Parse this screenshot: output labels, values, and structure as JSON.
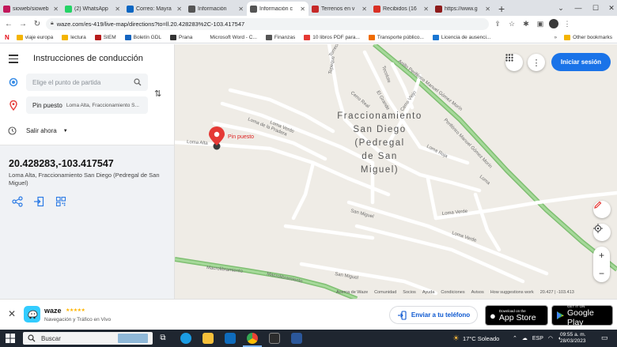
{
  "browser": {
    "tabs": [
      {
        "label": "sioweb/sioweb",
        "color": "#c2185b"
      },
      {
        "label": "(2) WhatsApp",
        "color": "#25d366"
      },
      {
        "label": "Correo: Mayra",
        "color": "#0a66c2"
      },
      {
        "label": "Información",
        "color": "#555555"
      },
      {
        "label": "Información c",
        "color": "#555555"
      },
      {
        "label": "Terrenos en v",
        "color": "#c62828"
      },
      {
        "label": "Recibidos (16",
        "color": "#d93025"
      },
      {
        "label": "https://www.g",
        "color": "#8e1b1b"
      }
    ],
    "url": "waze.com/es-419/live-map/directions?to=ll.20.428283%2C-103.417547",
    "bookmarks": [
      {
        "label": "viaje europa",
        "color": "#f4b400"
      },
      {
        "label": "lectura",
        "color": "#f4b400"
      },
      {
        "label": "SIEM",
        "color": "#b71c1c"
      },
      {
        "label": "Boletín GDL",
        "color": "#1565c0"
      },
      {
        "label": "Prana",
        "color": "#333333"
      },
      {
        "label": "Microsoft Word - C...",
        "color": "#ffffff"
      },
      {
        "label": "Finanzas",
        "color": "#555555"
      },
      {
        "label": "10 libros PDF para...",
        "color": "#e53935"
      },
      {
        "label": "Transporte público...",
        "color": "#ef6c00"
      },
      {
        "label": "Licencia de ausenci...",
        "color": "#1976d2"
      }
    ],
    "other_bookmarks": "Other bookmarks"
  },
  "panel": {
    "title": "Instrucciones de conducción",
    "origin_placeholder": "Elige el punto de partida",
    "destination_label": "Pin puesto",
    "destination_detail": "Loma Alta, Fraccionamiento S...",
    "depart": "Salir ahora",
    "coords": "20.428283,-103.417547",
    "address": "Loma Alta, Fraccionamiento San Diego (Pedregal de San Miguel)"
  },
  "map": {
    "neighborhood_label": [
      "Fraccionamiento",
      "San Diego",
      "(Pedregal",
      "de San",
      "Miguel)"
    ],
    "pin_label": "Pin puesto",
    "login": "Iniciar sesión",
    "streets": {
      "loma_alta": "Loma Alta",
      "loma_pradera": "Loma de la Pradera",
      "loma_verde_upper": "Loma Verde",
      "loma_verde_lower": "Loma Verde",
      "loma_verde_right": "Loma Verde",
      "san_miguel": "San Miguel",
      "san_miguel_lower": "San Miguel",
      "periferico": "Anillo Periférico Manuel Gómez Morín",
      "periferico_2": "Periférico Manuel Gómez Morín",
      "macrolibramiento": "Macrolibramiento",
      "macrolibramiento_2": "Macrolibramiento",
      "tepeque": "Tepeque",
      "cerro_real": "Cerro Real",
      "cerro_viejo": "Cerro Viejo",
      "el_grande": "El Grande",
      "loma_roja": "Loma Roja",
      "tecolote": "Tecolote",
      "torrecillas": "Torrecillas",
      "loma": "Loma"
    },
    "attribution": [
      "Acerca de Waze",
      "Comunidad",
      "Socios",
      "Ayuda",
      "Condiciones",
      "Avisos",
      "How suggestions work",
      "20.427 | -103.413"
    ]
  },
  "banner": {
    "app_name": "waze",
    "stars": "★★★★★",
    "subtitle": "Navegación y Tráfico en Vivo",
    "send": "Enviar a tu teléfono",
    "appstore_small": "Download on the",
    "appstore_big": "App Store",
    "play_small": "GET IT ON",
    "play_big": "Google Play"
  },
  "taskbar": {
    "search": "Buscar",
    "weather": "17°C  Soleado",
    "lang": "ESP",
    "time": "09:55 a. m.",
    "date": "28/03/2023"
  }
}
